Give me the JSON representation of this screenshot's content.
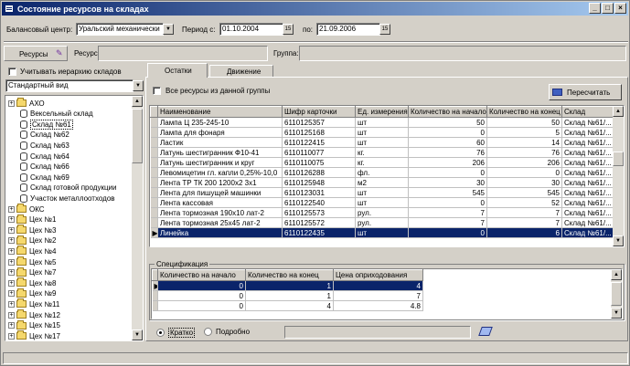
{
  "window": {
    "title": "Состояние ресурсов на складах",
    "buttons": {
      "minimize": "_",
      "maximize": "□",
      "close": "×"
    }
  },
  "filters": {
    "balance_center_label": "Балансовый центр:",
    "balance_center_value": "Уральский механически",
    "period_from_label": "Период с:",
    "period_from_value": "01.10.2004",
    "period_to_label": "по:",
    "period_to_value": "21.09.2006",
    "calendar_btn": "15"
  },
  "toolbar": {
    "resources_label": "Ресурсы",
    "resource_label": "Ресурс:",
    "group_label": "Группа:"
  },
  "sidebar": {
    "hierarchy_checkbox_label": "Учитывать иерархию складов",
    "view_select_value": "Стандартный вид",
    "tree": [
      {
        "label": "АХО",
        "icon": "folder",
        "level": 0,
        "expander": "+"
      },
      {
        "label": "Вексельный склад",
        "icon": "db",
        "level": 1
      },
      {
        "label": "Склад №61",
        "icon": "db",
        "level": 1,
        "selected": true
      },
      {
        "label": "Склад №62",
        "icon": "db",
        "level": 1
      },
      {
        "label": "Склад №63",
        "icon": "db",
        "level": 1
      },
      {
        "label": "Склад №64",
        "icon": "db",
        "level": 1
      },
      {
        "label": "Склад №66",
        "icon": "db",
        "level": 1
      },
      {
        "label": "Склад №69",
        "icon": "db",
        "level": 1
      },
      {
        "label": "Склад готовой продукции",
        "icon": "db",
        "level": 1
      },
      {
        "label": "Участок металлоотходов",
        "icon": "db",
        "level": 1
      },
      {
        "label": "ОКС",
        "icon": "folder",
        "level": 0,
        "expander": "+"
      },
      {
        "label": "Цех №1",
        "icon": "folder",
        "level": 0,
        "expander": "+"
      },
      {
        "label": "Цех №3",
        "icon": "folder",
        "level": 0,
        "expander": "+"
      },
      {
        "label": "Цех №2",
        "icon": "folder",
        "level": 0,
        "expander": "+"
      },
      {
        "label": "Цех №4",
        "icon": "folder",
        "level": 0,
        "expander": "+"
      },
      {
        "label": "Цех №5",
        "icon": "folder",
        "level": 0,
        "expander": "+"
      },
      {
        "label": "Цех №7",
        "icon": "folder",
        "level": 0,
        "expander": "+"
      },
      {
        "label": "Цех №8",
        "icon": "folder",
        "level": 0,
        "expander": "+"
      },
      {
        "label": "Цех №9",
        "icon": "folder",
        "level": 0,
        "expander": "+"
      },
      {
        "label": "Цех №11",
        "icon": "folder",
        "level": 0,
        "expander": "+"
      },
      {
        "label": "Цех №12",
        "icon": "folder",
        "level": 0,
        "expander": "+"
      },
      {
        "label": "Цех №15",
        "icon": "folder",
        "level": 0,
        "expander": "+"
      },
      {
        "label": "Цех №17",
        "icon": "folder",
        "level": 0,
        "expander": "+"
      }
    ]
  },
  "tabs": [
    {
      "label": "Остатки",
      "active": true
    },
    {
      "label": "Движение",
      "active": false
    }
  ],
  "main": {
    "all_resources_checkbox_label": "Все ресурсы из данной группы",
    "recalc_button": "Пересчитать",
    "columns": [
      "Наименование",
      "Шифр карточки",
      "Ед. измерения",
      "Количество на начало",
      "Количество на конец",
      "Склад"
    ],
    "rows": [
      [
        "Лампа Ц 235-245-10",
        "6110125357",
        "шт",
        "50",
        "50",
        "Склад №61/..."
      ],
      [
        "Лампа для фонаря",
        "6110125168",
        "шт",
        "0",
        "5",
        "Склад №61/..."
      ],
      [
        "Ластик",
        "6110122415",
        "шт",
        "60",
        "14",
        "Склад №61/..."
      ],
      [
        "Латунь шестигранник Ф10-41",
        "6110110077",
        "кг.",
        "76",
        "76",
        "Склад №61/..."
      ],
      [
        "Латунь шестигранник и круг",
        "6110110075",
        "кг.",
        "206",
        "206",
        "Склад №61/..."
      ],
      [
        "Левомицетин гл. капли 0,25%-10,0",
        "6110126288",
        "фл.",
        "0",
        "0",
        "Склад №61/..."
      ],
      [
        "Лента ТР ТК 200 1200х2 3х1",
        "6110125948",
        "м2",
        "30",
        "30",
        "Склад №61/..."
      ],
      [
        "Лента для пишущей машинки",
        "6110123031",
        "шт",
        "545",
        "545",
        "Склад №61/..."
      ],
      [
        "Лента кассовая",
        "6110122540",
        "шт",
        "0",
        "52",
        "Склад №61/..."
      ],
      [
        "Лента тормозная 190х10 лат-2",
        "6110125573",
        "рул.",
        "7",
        "7",
        "Склад №61/..."
      ],
      [
        "Лента тормозная 25х45 лат-2",
        "6110125572",
        "рул.",
        "7",
        "7",
        "Склад №61/..."
      ],
      [
        "Линейка",
        "6110122435",
        "шт",
        "0",
        "6",
        "Склад №61/..."
      ]
    ],
    "selected_row": 11
  },
  "spec": {
    "title": "Спецификация",
    "columns": [
      "Количество на начало",
      "Количество на конец",
      "Цена оприходования"
    ],
    "rows": [
      [
        "0",
        "1",
        "4"
      ],
      [
        "0",
        "1",
        "7"
      ],
      [
        "0",
        "4",
        "4.8"
      ]
    ]
  },
  "footer": {
    "radio_short": "Кратко",
    "radio_detail": "Подробно"
  }
}
